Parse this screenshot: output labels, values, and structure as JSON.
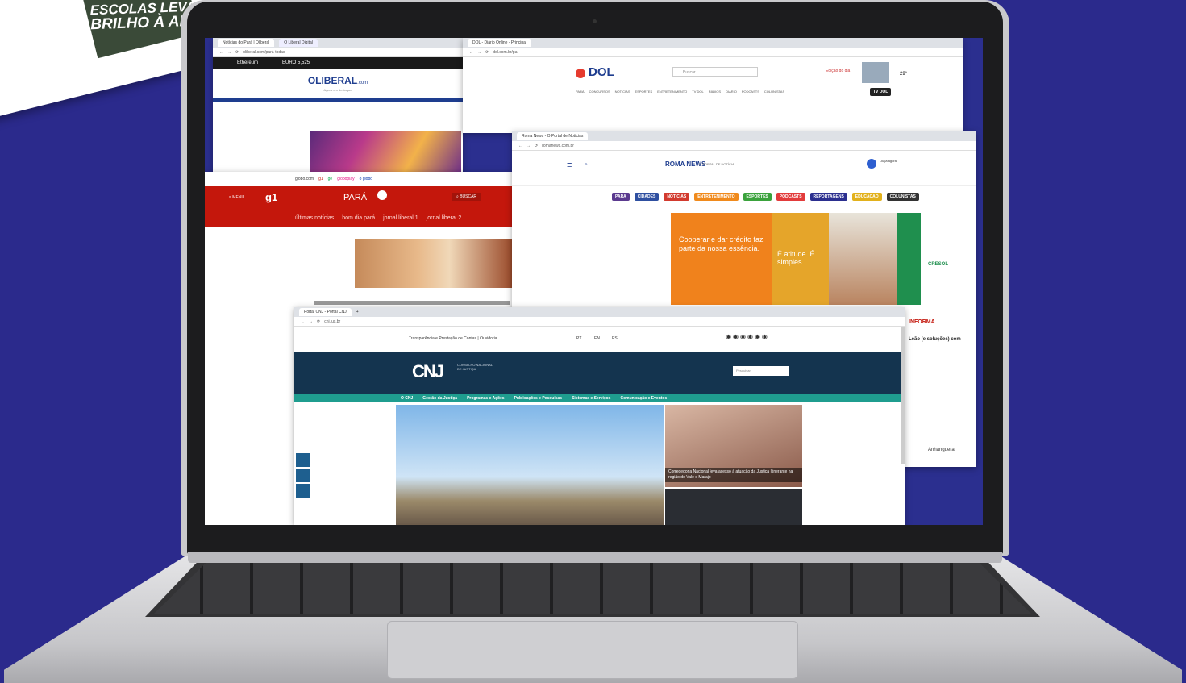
{
  "magazine": {
    "headline_line1": "ESCOLAS LEVA",
    "headline_line2": "BRILHO À AL"
  },
  "win_oliberal": {
    "tabs": [
      "Notícias do Pará | Oliberal",
      "O Liberal Digital"
    ],
    "url": "oliberal.com/pará-todas",
    "ticker": [
      "Ethereum",
      "EURO 5,525"
    ],
    "logo": "OLIBERAL",
    "logo_suffix": ".com",
    "tagline": "Agora em destaque"
  },
  "win_g1": {
    "top_links": [
      "globo.com",
      "g1",
      "ge",
      "globoplay",
      "o globo"
    ],
    "menu": "≡ MENU",
    "brand": "g1",
    "region": "PARÁ",
    "search": "BUSCAR",
    "nav": [
      "últimas notícias",
      "bom dia pará",
      "jornal liberal 1",
      "jornal liberal 2"
    ]
  },
  "win_dol": {
    "tab": "DOL - Diário Online - Principal",
    "url": "dol.com.br/pa",
    "logo": "DOL",
    "search_placeholder": "Buscar...",
    "edition": "Edição do dia",
    "temp": "29°",
    "nav": [
      "PARÁ",
      "CONCURSOS",
      "NOTÍCIAS",
      "ESPORTES",
      "ENTRETENIMENTO",
      "TV DOL",
      "RÁDIOS",
      "DIÁRIO",
      "PODCASTS",
      "COLUNISTAS"
    ],
    "tv_badge": "TV DOL"
  },
  "win_roma": {
    "tab": "Roma News - O Portal de Notícias",
    "url": "romanews.com.br",
    "logo": "ROMA NEWS",
    "logo_tag": "O PORTAL DE NOTÍCIA",
    "player_label": "Ouça agora",
    "categories": [
      {
        "label": "PARÁ",
        "color": "#5b3a8f"
      },
      {
        "label": "CIDADES",
        "color": "#2e4fa0"
      },
      {
        "label": "NOTÍCIAS",
        "color": "#d23a2e"
      },
      {
        "label": "ENTRETENIMENTO",
        "color": "#f08a1c"
      },
      {
        "label": "ESPORTES",
        "color": "#3aa23c"
      },
      {
        "label": "PODCASTS",
        "color": "#e23b3b"
      },
      {
        "label": "REPORTAGENS",
        "color": "#2b2f8f"
      },
      {
        "label": "EDUCAÇÃO",
        "color": "#e2b11c"
      },
      {
        "label": "COLUNISTAS",
        "color": "#333333"
      }
    ],
    "ad_text": "Cooperar e dar crédito faz parte da nossa essência.",
    "ad_slogan": "É atitude. É simples.",
    "ad_brand": "CRESOL",
    "side_title": "INFORMA",
    "side_headline": "Leão (e soluções) com",
    "side_brand": "Anhanguera"
  },
  "win_cnj": {
    "tab": "Portal CNJ - Portal CNJ",
    "url": "cnj.jus.br",
    "top_left": "Transparência e Prestação de Contas | Ouvidoria",
    "langs": [
      "PT",
      "EN",
      "ES"
    ],
    "logo": "CNJ",
    "logo_sub": "CONSELHO NACIONAL DE JUSTIÇA",
    "search_placeholder": "Pesquisar",
    "nav": [
      "O CNJ",
      "Gestão da Justiça",
      "Programas e Ações",
      "Publicações e Pesquisas",
      "Sistemas e Serviços",
      "Comunicação e Eventos"
    ],
    "caption": "Corregedoria Nacional leva acesso à atuação da Justiça Itinerante na região do Vale e Marajó"
  }
}
